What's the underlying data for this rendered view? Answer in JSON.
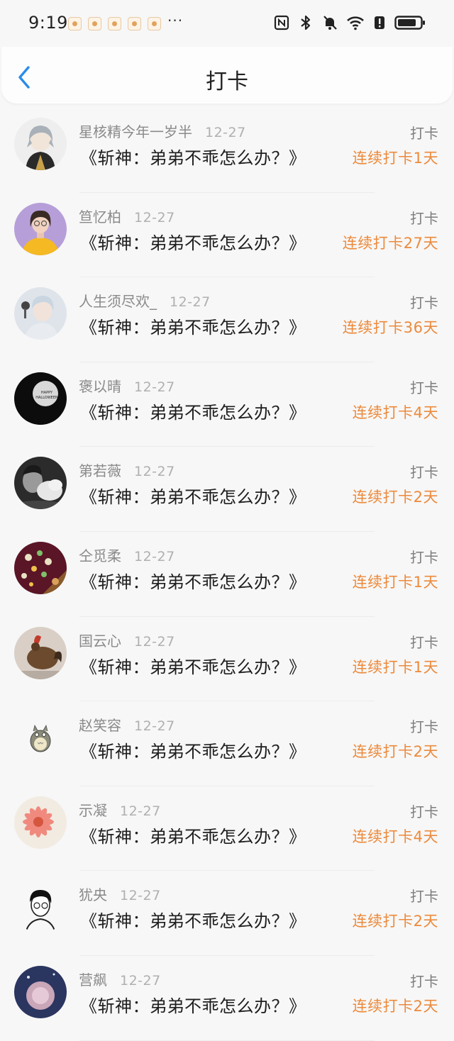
{
  "status_bar": {
    "time": "9:19",
    "more": "···",
    "notification_icons": [
      "app-icon",
      "app-icon",
      "app-icon",
      "app-icon",
      "app-icon"
    ],
    "right_icons": [
      "nfc-icon",
      "bluetooth-icon",
      "mute-icon",
      "wifi-icon",
      "alert-icon",
      "battery-icon"
    ]
  },
  "header": {
    "title": "打卡",
    "back_icon": "chevron-left-icon"
  },
  "theme": {
    "accent": "#2b8ce8",
    "streak_color": "#ec8a3c"
  },
  "entries": [
    {
      "name": "星核精今年一岁半",
      "date": "12-27",
      "book": "《斩神：弟弟不乖怎么办？》",
      "tag": "打卡",
      "streak": "连续打卡1天"
    },
    {
      "name": "笪忆柏",
      "date": "12-27",
      "book": "《斩神：弟弟不乖怎么办？》",
      "tag": "打卡",
      "streak": "连续打卡27天"
    },
    {
      "name": "人生须尽欢_",
      "date": "12-27",
      "book": "《斩神：弟弟不乖怎么办？》",
      "tag": "打卡",
      "streak": "连续打卡36天"
    },
    {
      "name": "褒以晴",
      "date": "12-27",
      "book": "《斩神：弟弟不乖怎么办？》",
      "tag": "打卡",
      "streak": "连续打卡4天",
      "avatar_text": [
        "HAPPY",
        "HALLOWEEN"
      ]
    },
    {
      "name": "第若薇",
      "date": "12-27",
      "book": "《斩神：弟弟不乖怎么办？》",
      "tag": "打卡",
      "streak": "连续打卡2天"
    },
    {
      "name": "仝觅柔",
      "date": "12-27",
      "book": "《斩神：弟弟不乖怎么办？》",
      "tag": "打卡",
      "streak": "连续打卡1天"
    },
    {
      "name": "国云心",
      "date": "12-27",
      "book": "《斩神：弟弟不乖怎么办？》",
      "tag": "打卡",
      "streak": "连续打卡1天"
    },
    {
      "name": "赵笑容",
      "date": "12-27",
      "book": "《斩神：弟弟不乖怎么办？》",
      "tag": "打卡",
      "streak": "连续打卡2天"
    },
    {
      "name": "示凝",
      "date": "12-27",
      "book": "《斩神：弟弟不乖怎么办？》",
      "tag": "打卡",
      "streak": "连续打卡4天"
    },
    {
      "name": "犹央",
      "date": "12-27",
      "book": "《斩神：弟弟不乖怎么办？》",
      "tag": "打卡",
      "streak": "连续打卡2天"
    },
    {
      "name": "营飙",
      "date": "12-27",
      "book": "《斩神：弟弟不乖怎么办？》",
      "tag": "打卡",
      "streak": "连续打卡2天"
    }
  ]
}
